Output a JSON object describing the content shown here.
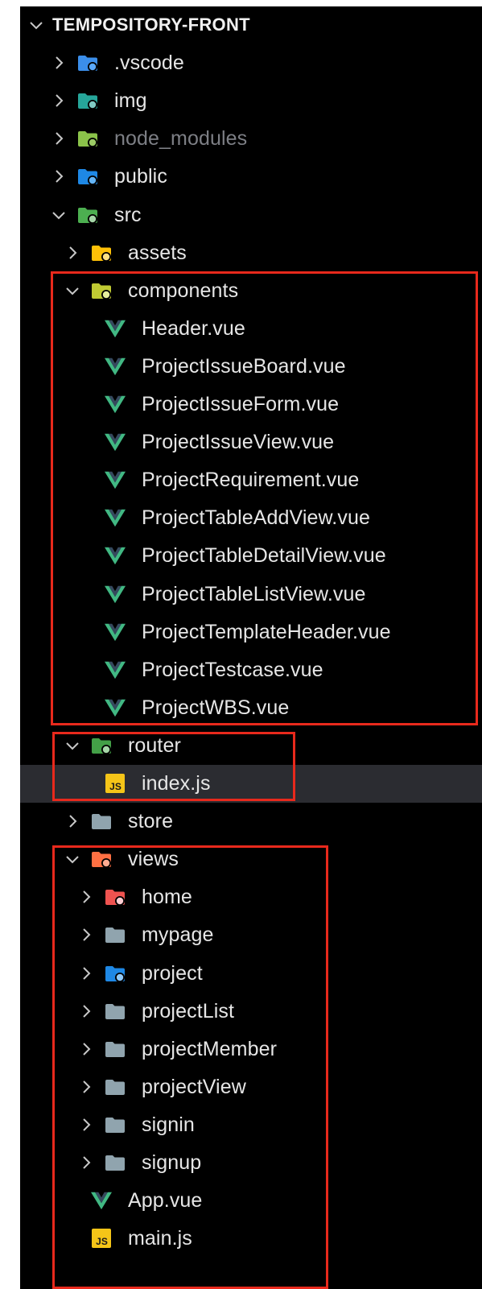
{
  "explorer": {
    "title": "TEMPOSITORY-FRONT",
    "rows": [
      {
        "label": "TEMPOSITORY-FRONT",
        "type": "root",
        "depth": 0,
        "expanded": true
      },
      {
        "label": ".vscode",
        "type": "folder",
        "depth": 1,
        "expanded": false,
        "icon": "vscode-folder-icon",
        "color": "#3b8eea"
      },
      {
        "label": "img",
        "type": "folder",
        "depth": 1,
        "expanded": false,
        "icon": "image-folder-icon",
        "color": "#26a69a"
      },
      {
        "label": "node_modules",
        "type": "folder",
        "depth": 1,
        "expanded": false,
        "icon": "node-folder-icon",
        "color": "#8bc34a",
        "dim": true
      },
      {
        "label": "public",
        "type": "folder",
        "depth": 1,
        "expanded": false,
        "icon": "public-folder-icon",
        "color": "#1e88e5"
      },
      {
        "label": "src",
        "type": "folder",
        "depth": 1,
        "expanded": true,
        "icon": "src-folder-icon",
        "color": "#4caf50"
      },
      {
        "label": "assets",
        "type": "folder",
        "depth": 2,
        "expanded": false,
        "icon": "assets-folder-icon",
        "color": "#ffc107"
      },
      {
        "label": "components",
        "type": "folder",
        "depth": 2,
        "expanded": true,
        "icon": "components-folder-icon",
        "color": "#c0ca33"
      },
      {
        "label": "Header.vue",
        "type": "vue",
        "depth": 3
      },
      {
        "label": "ProjectIssueBoard.vue",
        "type": "vue",
        "depth": 3
      },
      {
        "label": "ProjectIssueForm.vue",
        "type": "vue",
        "depth": 3
      },
      {
        "label": "ProjectIssueView.vue",
        "type": "vue",
        "depth": 3
      },
      {
        "label": "ProjectRequirement.vue",
        "type": "vue",
        "depth": 3
      },
      {
        "label": "ProjectTableAddView.vue",
        "type": "vue",
        "depth": 3
      },
      {
        "label": "ProjectTableDetailView.vue",
        "type": "vue",
        "depth": 3
      },
      {
        "label": "ProjectTableListView.vue",
        "type": "vue",
        "depth": 3
      },
      {
        "label": "ProjectTemplateHeader.vue",
        "type": "vue",
        "depth": 3
      },
      {
        "label": "ProjectTestcase.vue",
        "type": "vue",
        "depth": 3
      },
      {
        "label": "ProjectWBS.vue",
        "type": "vue",
        "depth": 3
      },
      {
        "label": "router",
        "type": "folder",
        "depth": 2,
        "expanded": true,
        "icon": "router-folder-icon",
        "color": "#43a047"
      },
      {
        "label": "index.js",
        "type": "js",
        "depth": 3,
        "selected": true
      },
      {
        "label": "store",
        "type": "folder",
        "depth": 2,
        "expanded": false,
        "icon": "folder-icon",
        "color": "#90a4ae"
      },
      {
        "label": "views",
        "type": "folder",
        "depth": 2,
        "expanded": true,
        "icon": "views-folder-icon",
        "color": "#ff7043"
      },
      {
        "label": "home",
        "type": "folder",
        "depth": 3,
        "expanded": false,
        "icon": "home-folder-icon",
        "color": "#ef5350"
      },
      {
        "label": "mypage",
        "type": "folder",
        "depth": 3,
        "expanded": false,
        "icon": "folder-icon",
        "color": "#90a4ae"
      },
      {
        "label": "project",
        "type": "folder",
        "depth": 3,
        "expanded": false,
        "icon": "project-folder-icon",
        "color": "#1e88e5"
      },
      {
        "label": "projectList",
        "type": "folder",
        "depth": 3,
        "expanded": false,
        "icon": "folder-icon",
        "color": "#90a4ae"
      },
      {
        "label": "projectMember",
        "type": "folder",
        "depth": 3,
        "expanded": false,
        "icon": "folder-icon",
        "color": "#90a4ae"
      },
      {
        "label": "projectView",
        "type": "folder",
        "depth": 3,
        "expanded": false,
        "icon": "folder-icon",
        "color": "#90a4ae"
      },
      {
        "label": "signin",
        "type": "folder",
        "depth": 3,
        "expanded": false,
        "icon": "folder-icon",
        "color": "#90a4ae"
      },
      {
        "label": "signup",
        "type": "folder",
        "depth": 3,
        "expanded": false,
        "icon": "folder-icon",
        "color": "#90a4ae"
      },
      {
        "label": "App.vue",
        "type": "vue",
        "depth": 2
      },
      {
        "label": "main.js",
        "type": "js",
        "depth": 2
      }
    ],
    "highlights": [
      {
        "name": "components-highlight",
        "color": "#e8291c"
      },
      {
        "name": "router-highlight",
        "color": "#e8291c"
      },
      {
        "name": "views-highlight",
        "color": "#e8291c"
      }
    ],
    "colors": {
      "background": "#000000",
      "selected_row": "#2b2c31",
      "text": "#e6e6e6",
      "vue_green": "#41b883",
      "vue_dark": "#35495e",
      "js_yellow": "#f5c518"
    }
  }
}
